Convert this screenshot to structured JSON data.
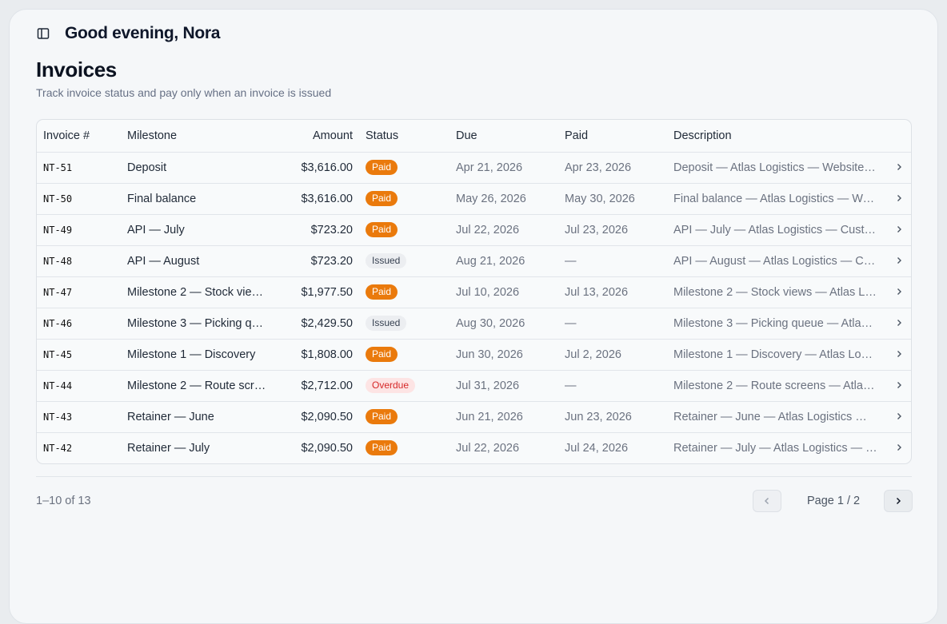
{
  "header": {
    "greeting": "Good evening, Nora",
    "sidebar_toggle_icon": "sidebar-panel-icon"
  },
  "page": {
    "title": "Invoices",
    "subtitle": "Track invoice status and pay only when an invoice is issued"
  },
  "table": {
    "columns": [
      "Invoice #",
      "Milestone",
      "Amount",
      "Status",
      "Due",
      "Paid",
      "Description"
    ],
    "rows": [
      {
        "id": "NT-51",
        "milestone": "Deposit",
        "amount": "$3,616.00",
        "status": "Paid",
        "due": "Apr 21, 2026",
        "paid": "Apr 23, 2026",
        "description": "Deposit — Atlas Logistics — Website…"
      },
      {
        "id": "NT-50",
        "milestone": "Final balance",
        "amount": "$3,616.00",
        "status": "Paid",
        "due": "May 26, 2026",
        "paid": "May 30, 2026",
        "description": "Final balance — Atlas Logistics — We…"
      },
      {
        "id": "NT-49",
        "milestone": "API — July",
        "amount": "$723.20",
        "status": "Paid",
        "due": "Jul 22, 2026",
        "paid": "Jul 23, 2026",
        "description": "API — July — Atlas Logistics — Custo…"
      },
      {
        "id": "NT-48",
        "milestone": "API — August",
        "amount": "$723.20",
        "status": "Issued",
        "due": "Aug 21, 2026",
        "paid": "—",
        "description": "API — August — Atlas Logistics — Cu…"
      },
      {
        "id": "NT-47",
        "milestone": "Milestone 2 — Stock vie…",
        "amount": "$1,977.50",
        "status": "Paid",
        "due": "Jul 10, 2026",
        "paid": "Jul 13, 2026",
        "description": "Milestone 2 — Stock views — Atlas L…"
      },
      {
        "id": "NT-46",
        "milestone": "Milestone 3 — Picking q…",
        "amount": "$2,429.50",
        "status": "Issued",
        "due": "Aug 30, 2026",
        "paid": "—",
        "description": "Milestone 3 — Picking queue — Atlas …"
      },
      {
        "id": "NT-45",
        "milestone": "Milestone 1 — Discovery",
        "amount": "$1,808.00",
        "status": "Paid",
        "due": "Jun 30, 2026",
        "paid": "Jul 2, 2026",
        "description": "Milestone 1 — Discovery — Atlas Logi…"
      },
      {
        "id": "NT-44",
        "milestone": "Milestone 2 — Route scr…",
        "amount": "$2,712.00",
        "status": "Overdue",
        "due": "Jul 31, 2026",
        "paid": "—",
        "description": "Milestone 2 — Route screens — Atlas …"
      },
      {
        "id": "NT-43",
        "milestone": "Retainer — June",
        "amount": "$2,090.50",
        "status": "Paid",
        "due": "Jun 21, 2026",
        "paid": "Jun 23, 2026",
        "description": "Retainer — June — Atlas Logistics — …"
      },
      {
        "id": "NT-42",
        "milestone": "Retainer — July",
        "amount": "$2,090.50",
        "status": "Paid",
        "due": "Jul 22, 2026",
        "paid": "Jul 24, 2026",
        "description": "Retainer — July — Atlas Logistics — B…"
      }
    ],
    "row_action_icon": "chevron-right-icon"
  },
  "pagination": {
    "range": "1–10 of 13",
    "page_label": "Page 1 / 2",
    "prev_icon": "chevron-left-icon",
    "next_icon": "chevron-right-icon"
  },
  "colors": {
    "paid": "#ea7a0c",
    "issued": "#eceef1",
    "overdue": "#fde4e4",
    "overdue_text": "#d62828"
  }
}
